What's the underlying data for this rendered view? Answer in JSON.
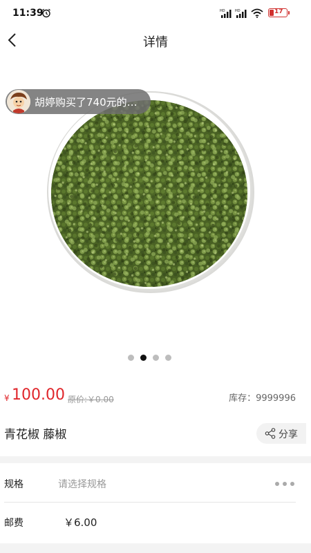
{
  "status_bar": {
    "time": "11:39",
    "battery_level": "17",
    "icons": [
      "alarm-icon",
      "signal-hd-icon",
      "signal-hd-icon",
      "wifi-icon",
      "battery-icon"
    ],
    "signal_labels": [
      "HD",
      "HD"
    ]
  },
  "nav": {
    "title": "详情",
    "back_icon": "chevron-left-icon"
  },
  "gallery": {
    "toast_text": "胡婷购买了740元的…",
    "slide_count": 4,
    "active_slide": 2,
    "image_description_icon": "product-photo"
  },
  "price": {
    "currency_symbol": "¥",
    "current": "100.00",
    "original": "原价:￥0.00",
    "stock": "库存：9999996",
    "accent_color": "#e0262b"
  },
  "product": {
    "name": "青花椒 藤椒",
    "share_label": "分享",
    "share_icon": "share-icon"
  },
  "spec": {
    "label": "规格",
    "placeholder": "请选择规格",
    "more_icon": "more-dots-icon"
  },
  "shipping": {
    "label": "邮费",
    "value": "￥6.00"
  }
}
